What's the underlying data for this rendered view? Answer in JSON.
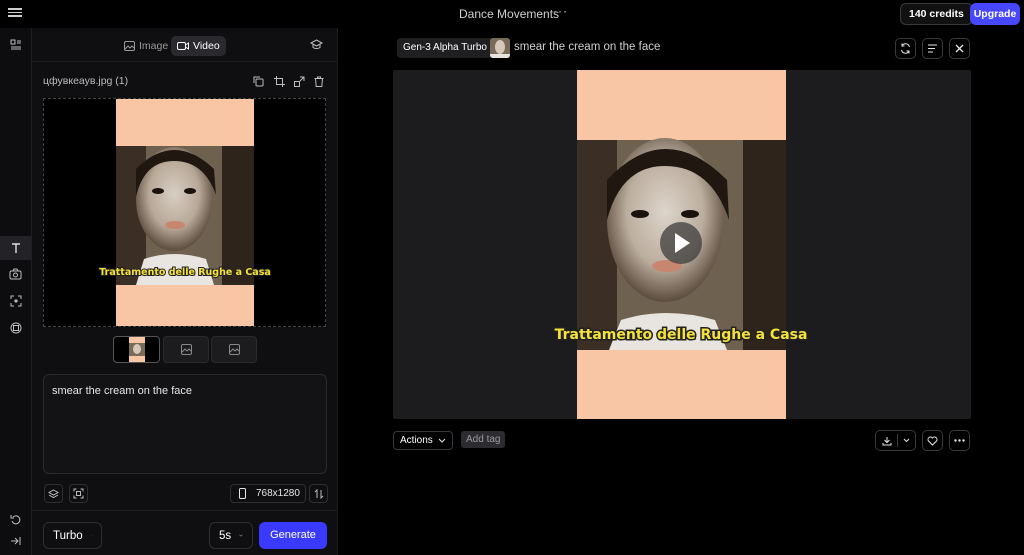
{
  "app": {
    "project_title": "Dance Movements",
    "credits": "140 credits",
    "upgrade_label": "Upgrade"
  },
  "panel": {
    "tabs": [
      {
        "label": "Image"
      },
      {
        "label": "Video"
      }
    ],
    "file_name": "цфувкеаув.jpg (1)",
    "prompt_text": "smear the cream on the face",
    "resolution": "768x1280",
    "mode": "Turbo",
    "duration": "5s",
    "generate_label": "Generate"
  },
  "main": {
    "model": "Gen-3 Alpha Turbo",
    "prompt_title": "smear the cream on the face",
    "actions_label": "Actions",
    "add_tag_label": "Add tag"
  },
  "media": {
    "caption": "Trattamento delle Rughe a Casa"
  },
  "colors": {
    "accent": "#4747ff",
    "generate": "#3a3aff",
    "background": "#000000",
    "peach": "#f8c6a4"
  },
  "icons": [
    "hamburger-icon",
    "image-icon",
    "video-icon",
    "graduation-cap-icon",
    "copy-icon",
    "crop-icon",
    "resize-icon",
    "trash-icon",
    "text-icon",
    "camera-icon",
    "focus-icon",
    "globe-icon",
    "undo-icon",
    "collapse-icon",
    "layers-icon",
    "scan-icon",
    "phone-icon",
    "swap-icon",
    "refresh-icon",
    "menu-icon",
    "close-icon",
    "play-icon",
    "download-icon",
    "heart-icon",
    "more-icon"
  ]
}
